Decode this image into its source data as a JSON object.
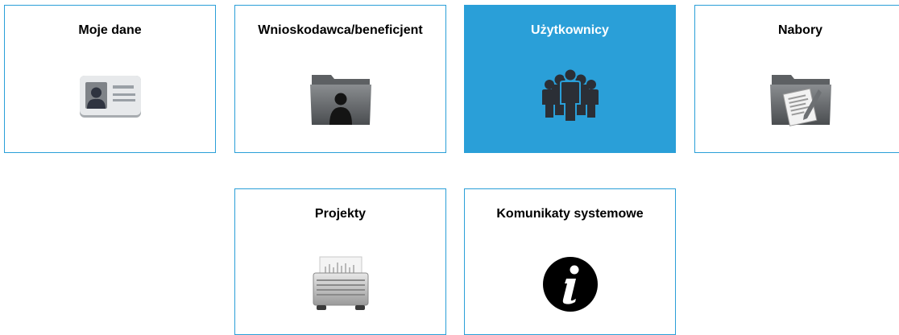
{
  "tiles": [
    {
      "label": "Moje dane",
      "icon": "id-card-icon",
      "active": false
    },
    {
      "label": "Wnioskodawca/beneficjent",
      "icon": "folder-person-icon",
      "active": false
    },
    {
      "label": "Użytkownicy",
      "icon": "users-group-icon",
      "active": true
    },
    {
      "label": "Nabory",
      "icon": "folder-document-icon",
      "active": false
    },
    {
      "label": "Projekty",
      "icon": "file-cabinet-icon",
      "active": false
    },
    {
      "label": "Komunikaty systemowe",
      "icon": "info-icon",
      "active": false
    }
  ],
  "colors": {
    "accent": "#2a9fd8",
    "border": "#2a9fd8",
    "active_text": "#ffffff",
    "text": "#000000"
  }
}
